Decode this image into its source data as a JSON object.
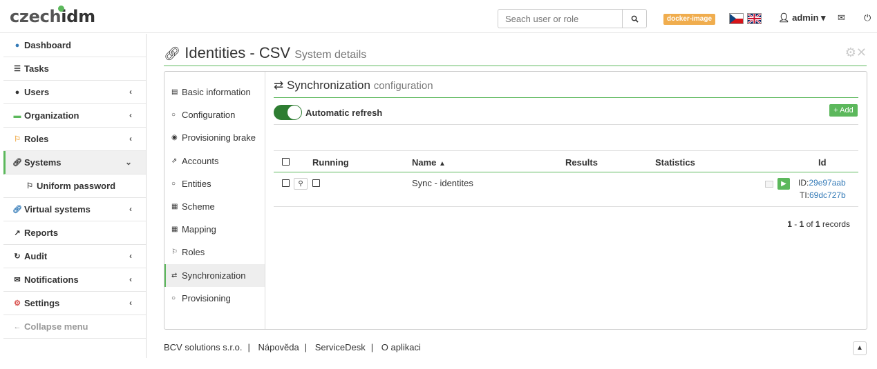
{
  "brand": {
    "part1": "czech",
    "part2": "idm"
  },
  "search": {
    "placeholder": "Seach user or role"
  },
  "env_badge": "docker-image",
  "user": {
    "name": "admin"
  },
  "sidebar": {
    "items": [
      {
        "label": "Dashboard",
        "icon": "user-icon"
      },
      {
        "label": "Tasks",
        "icon": "list-icon"
      },
      {
        "label": "Users",
        "icon": "users-icon"
      },
      {
        "label": "Organization",
        "icon": "folder-icon"
      },
      {
        "label": "Roles",
        "icon": "key-icon"
      },
      {
        "label": "Systems",
        "icon": "link-icon"
      },
      {
        "label": "Uniform password",
        "icon": "key-icon"
      },
      {
        "label": "Virtual systems",
        "icon": "link-icon"
      },
      {
        "label": "Reports",
        "icon": "chart-icon"
      },
      {
        "label": "Audit",
        "icon": "history-icon"
      },
      {
        "label": "Notifications",
        "icon": "envelope-icon"
      },
      {
        "label": "Settings",
        "icon": "gear-icon"
      },
      {
        "label": "Collapse menu",
        "icon": "arrow-left-icon"
      }
    ]
  },
  "header": {
    "title": "Identities - CSV",
    "subtitle": "System details"
  },
  "subnav": {
    "items": [
      {
        "label": "Basic information"
      },
      {
        "label": "Configuration"
      },
      {
        "label": "Provisioning brake"
      },
      {
        "label": "Accounts"
      },
      {
        "label": "Entities"
      },
      {
        "label": "Scheme"
      },
      {
        "label": "Mapping"
      },
      {
        "label": "Roles"
      },
      {
        "label": "Synchronization"
      },
      {
        "label": "Provisioning"
      }
    ]
  },
  "section": {
    "title": "Synchronization",
    "subtitle": "configuration"
  },
  "auto_refresh": {
    "label": "Automatic refresh",
    "enabled": true
  },
  "add_button": "Add",
  "table": {
    "columns": [
      "Running",
      "Name",
      "Results",
      "Statistics",
      "Id"
    ],
    "rows": [
      {
        "name": "Sync - identites",
        "id_label": "ID:",
        "id_value": "29e97aab",
        "ti_label": "TI:",
        "ti_value": "69dc727b"
      }
    ]
  },
  "pager": {
    "from": "1",
    "to": "1",
    "total": "1",
    "of": "of",
    "suffix": "records"
  },
  "footer": {
    "links": [
      "BCV solutions s.r.o.",
      "Nápověda",
      "ServiceDesk",
      "O aplikaci"
    ]
  }
}
